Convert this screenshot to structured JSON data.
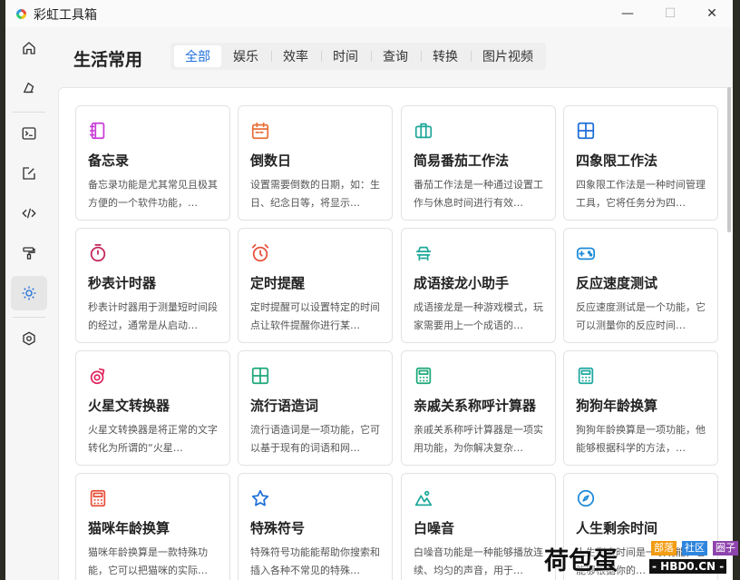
{
  "window": {
    "title": "彩虹工具箱",
    "controls": {
      "minimize": "—",
      "maximize": "☐",
      "close": "✕"
    }
  },
  "sidebar": {
    "items": [
      {
        "icon": "home-icon"
      },
      {
        "icon": "theme-icon"
      },
      {
        "icon": "terminal-icon"
      },
      {
        "icon": "edit-icon"
      },
      {
        "icon": "code-icon"
      },
      {
        "icon": "paint-roller-icon"
      },
      {
        "icon": "sun-icon",
        "active": true
      },
      {
        "icon": "settings-icon"
      }
    ]
  },
  "main": {
    "title": "生活常用",
    "tabs": [
      "全部",
      "娱乐",
      "效率",
      "时间",
      "查询",
      "转换",
      "图片视频"
    ],
    "active_tab": 0
  },
  "cards": [
    {
      "icon": "notebook-icon",
      "color": "#c83dd6",
      "name": "备忘录",
      "desc": "备忘录功能是尤其常见且极其方便的一个软件功能，…"
    },
    {
      "icon": "calendar-icon",
      "color": "#e8703a",
      "name": "倒数日",
      "desc": "设置需要倒数的日期，如：生日、纪念日等，将显示…"
    },
    {
      "icon": "briefcase-icon",
      "color": "#1fa89a",
      "name": "简易番茄工作法",
      "desc": "番茄工作法是一种通过设置工作与休息时间进行有效…"
    },
    {
      "icon": "grid-icon",
      "color": "#1e6fd9",
      "name": "四象限工作法",
      "desc": "四象限工作法是一种时间管理工具，它将任务分为四…"
    },
    {
      "icon": "stopwatch-icon",
      "color": "#c2255c",
      "name": "秒表计时器",
      "desc": "秒表计时器用于测量短时间段的经过，通常是从启动…"
    },
    {
      "icon": "alarm-icon",
      "color": "#e8503a",
      "name": "定时提醒",
      "desc": "定时提醒可以设置特定的时间点让软件提醒你进行某…"
    },
    {
      "icon": "dragon-icon",
      "color": "#1fa89a",
      "name": "成语接龙小助手",
      "desc": "成语接龙是一种游戏模式，玩家需要用上一个成语的…"
    },
    {
      "icon": "gamepad-icon",
      "color": "#1e8ad9",
      "name": "反应速度测试",
      "desc": "反应速度测试是一个功能，它可以测量你的反应时间…"
    },
    {
      "icon": "mars-icon",
      "color": "#e0245e",
      "name": "火星文转换器",
      "desc": "火星文转换器是将正常的文字转化为所谓的“火星…"
    },
    {
      "icon": "grid-icon",
      "color": "#1fa87a",
      "name": "流行语造词",
      "desc": "流行语造词是一项功能，它可以基于现有的词语和网…"
    },
    {
      "icon": "calculator-icon",
      "color": "#1fa87a",
      "name": "亲戚关系称呼计算器",
      "desc": "亲戚关系称呼计算器是一项实用功能，为你解决复杂…"
    },
    {
      "icon": "calculator-icon",
      "color": "#1fa8a0",
      "name": "狗狗年龄换算",
      "desc": "狗狗年龄换算是一项功能，他能够根据科学的方法，…"
    },
    {
      "icon": "calculator-icon",
      "color": "#e8503a",
      "name": "猫咪年龄换算",
      "desc": "猫咪年龄换算是一款特殊功能，它可以把猫咪的实际…"
    },
    {
      "icon": "star-icon",
      "color": "#1e6fd9",
      "name": "特殊符号",
      "desc": "特殊符号功能能帮助你搜索和插入各种不常见的特殊…"
    },
    {
      "icon": "landscape-icon",
      "color": "#1fa89a",
      "name": "白噪音",
      "desc": "白噪音功能是一种能够播放连续、均匀的声音，用于…"
    },
    {
      "icon": "compass-icon",
      "color": "#1e8ad9",
      "name": "人生剩余时间",
      "desc": "人生剩余时间是一项功能，它能够根据你的…"
    }
  ],
  "watermark": {
    "text": "荷包蛋",
    "tags": [
      "部落",
      "社区",
      "圈子"
    ],
    "tag_colors": [
      "#f39c12",
      "#2e86de",
      "#8e44ad"
    ],
    "url": "- HBD0.CN -"
  }
}
